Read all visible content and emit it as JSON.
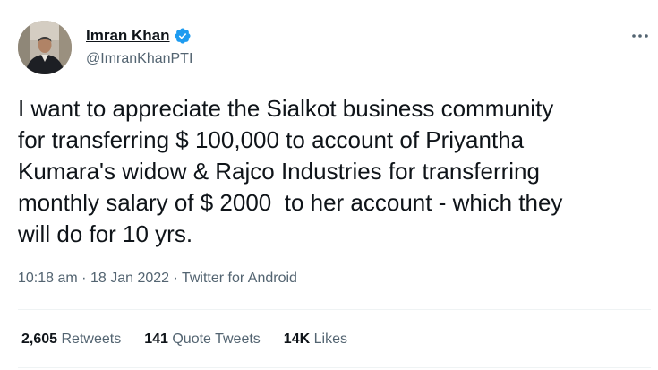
{
  "author": {
    "display_name": "Imran Khan",
    "handle": "@ImranKhanPTI",
    "verified": true
  },
  "tweet": {
    "text": "I want to appreciate the Sialkot business community\nfor transferring $ 100,000 to account of Priyantha\nKumara's widow & Rajco Industries for transferring\nmonthly salary of $ 2000  to her account - which they\nwill do for 10 yrs.",
    "time": "10:18 am",
    "separator_1": "·",
    "date": "18 Jan 2022",
    "separator_2": "·",
    "source": "Twitter for Android"
  },
  "stats": {
    "retweets_count": "2,605",
    "retweets_label": "Retweets",
    "quotes_count": "141",
    "quotes_label": "Quote Tweets",
    "likes_count": "14K",
    "likes_label": "Likes"
  },
  "icons": {
    "verified": "verified-badge-icon",
    "more": "more-options-icon"
  },
  "colors": {
    "text_primary": "#0f1419",
    "text_secondary": "#536471",
    "verified_blue": "#1d9bf0",
    "divider": "#eff3f4"
  }
}
